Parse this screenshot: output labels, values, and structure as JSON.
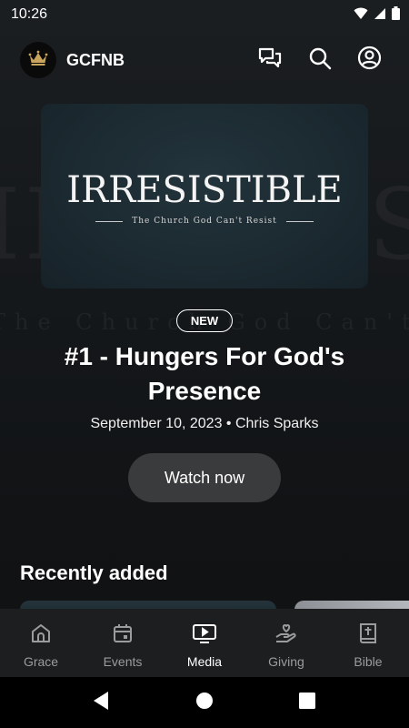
{
  "status_bar": {
    "time": "10:26"
  },
  "header": {
    "title": "GCFNB"
  },
  "hero": {
    "art_title": "IRRESISTIBLE",
    "art_subtitle": "The Church God Can't Resist",
    "badge": "NEW",
    "title": "#1 - Hungers For God's Presence",
    "meta": "September 10, 2023 • Chris Sparks",
    "cta": "Watch now"
  },
  "section": {
    "title": "Recently added"
  },
  "nav": {
    "items": [
      {
        "label": "Grace",
        "icon": "church-icon"
      },
      {
        "label": "Events",
        "icon": "calendar-icon"
      },
      {
        "label": "Media",
        "icon": "tv-play-icon"
      },
      {
        "label": "Giving",
        "icon": "giving-hand-icon"
      },
      {
        "label": "Bible",
        "icon": "bible-icon"
      }
    ],
    "active": "Media"
  },
  "colors": {
    "background": "#15181b",
    "nav_bar": "#1c1e20",
    "button": "#3a3b3c",
    "inactive": "#9a9c9e",
    "logo_crown": "#c9a45c"
  }
}
